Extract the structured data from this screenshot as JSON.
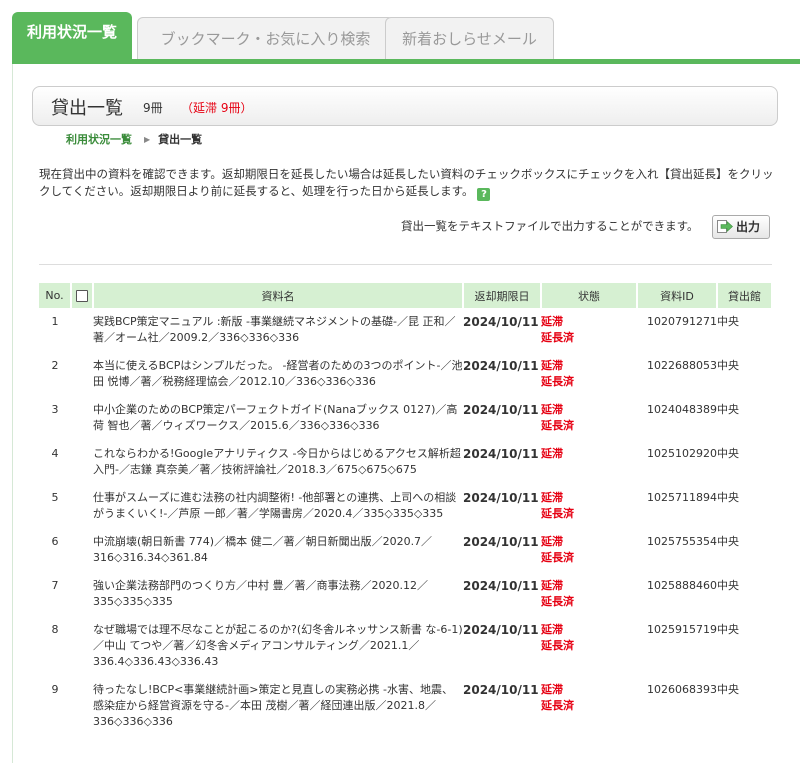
{
  "tabs": [
    {
      "label": "利用状況一覧",
      "active": true
    },
    {
      "label": "ブックマーク・お気に入り検索",
      "active": false
    },
    {
      "label": "新着おしらせメール",
      "active": false
    }
  ],
  "colors": {
    "accent": "#5ab85c",
    "overdue": "#e60012",
    "header_bg": "#d6f0d2"
  },
  "page": {
    "title": "貸出一覧",
    "count": "9冊",
    "overdue": "（延滞 9冊）",
    "breadcrumb": {
      "parent": "利用状況一覧",
      "sep": "▶",
      "current": "貸出一覧"
    },
    "description": "現在貸出中の資料を確認できます。返却期限日を延長したい場合は延長したい資料のチェックボックスにチェックを入れ【貸出延長】をクリックしてください。返却期限日より前に延長すると、処理を行った日から延長します。",
    "help_icon": "?",
    "export_note": "貸出一覧をテキストファイルで出力することができます。",
    "export_label": "出力"
  },
  "table": {
    "headers": {
      "no": "No.",
      "title": "資料名",
      "due": "返却期限日",
      "status": "状態",
      "id": "資料ID",
      "branch": "貸出館"
    },
    "rows": [
      {
        "no": "1",
        "title": "実践BCP策定マニュアル :新版 -事業継続マネジメントの基礎-／昆 正和／著／オーム社／2009.2／336◇336◇336",
        "due": "2024/10/11",
        "status1": "延滞",
        "status2": "延長済",
        "id": "1020791271",
        "branch": "中央"
      },
      {
        "no": "2",
        "title": "本当に使えるBCPはシンプルだった。 -経営者のための3つのポイント-／池田 悦博／著／税務経理協会／2012.10／336◇336◇336",
        "due": "2024/10/11",
        "status1": "延滞",
        "status2": "延長済",
        "id": "1022688053",
        "branch": "中央"
      },
      {
        "no": "3",
        "title": "中小企業のためのBCP策定パーフェクトガイド(Nanaブックス 0127)／高荷 智也／著／ウィズワークス／2015.6／336◇336◇336",
        "due": "2024/10/11",
        "status1": "延滞",
        "status2": "延長済",
        "id": "1024048389",
        "branch": "中央"
      },
      {
        "no": "4",
        "title": "これならわかる!Googleアナリティクス -今日からはじめるアクセス解析超入門-／志鎌 真奈美／著／技術評論社／2018.3／675◇675◇675",
        "due": "2024/10/11",
        "status1": "延滞",
        "status2": "",
        "id": "1025102920",
        "branch": "中央"
      },
      {
        "no": "5",
        "title": "仕事がスムーズに進む法務の社内調整術! -他部署との連携、上司への相談がうまくいく!-／芦原 一郎／著／学陽書房／2020.4／335◇335◇335",
        "due": "2024/10/11",
        "status1": "延滞",
        "status2": "延長済",
        "id": "1025711894",
        "branch": "中央"
      },
      {
        "no": "6",
        "title": "中流崩壊(朝日新書 774)／橋本 健二／著／朝日新聞出版／2020.7／316◇316.34◇361.84",
        "due": "2024/10/11",
        "status1": "延滞",
        "status2": "延長済",
        "id": "1025755354",
        "branch": "中央"
      },
      {
        "no": "7",
        "title": "強い企業法務部門のつくり方／中村 豊／著／商事法務／2020.12／335◇335◇335",
        "due": "2024/10/11",
        "status1": "延滞",
        "status2": "延長済",
        "id": "1025888460",
        "branch": "中央"
      },
      {
        "no": "8",
        "title": "なぜ職場では理不尽なことが起こるのか?(幻冬舎ルネッサンス新書 な-6-1)／中山 てつや／著／幻冬舎メディアコンサルティング／2021.1／336.4◇336.43◇336.43",
        "due": "2024/10/11",
        "status1": "延滞",
        "status2": "延長済",
        "id": "1025915719",
        "branch": "中央"
      },
      {
        "no": "9",
        "title": "待ったなし!BCP<事業継続計画>策定と見直しの実務必携 -水害、地震、感染症から経営資源を守る-／本田 茂樹／著／経団連出版／2021.8／336◇336◇336",
        "due": "2024/10/11",
        "status1": "延滞",
        "status2": "延長済",
        "id": "1026068393",
        "branch": "中央"
      }
    ]
  }
}
